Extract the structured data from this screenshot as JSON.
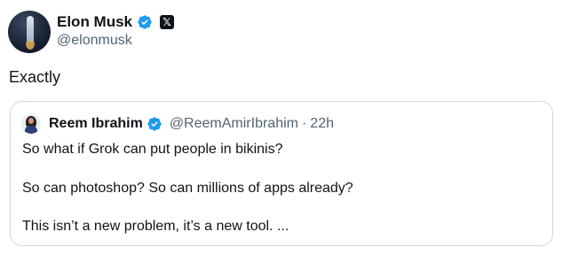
{
  "author": {
    "display_name": "Elon Musk",
    "handle": "@elonmusk",
    "verified_color": "#1d9bf0",
    "avatar_icon": "rocket-avatar",
    "affiliation_icon": "x-logo-icon",
    "affiliation_glyph": "𝕏"
  },
  "tweet": {
    "text": "Exactly"
  },
  "quoted": {
    "display_name": "Reem Ibrahim",
    "handle": "@ReemAmirIbrahim",
    "separator": "·",
    "time": "22h",
    "avatar_icon": "person-avatar",
    "lines": [
      "So what if Grok can put people in bikinis?",
      "So can photoshop? So can millions of apps already?",
      "This isn’t a new problem, it’s a new tool. ..."
    ]
  },
  "colors": {
    "text_primary": "#0f1419",
    "text_secondary": "#536471",
    "border": "#cfd9de",
    "verified": "#1d9bf0"
  }
}
